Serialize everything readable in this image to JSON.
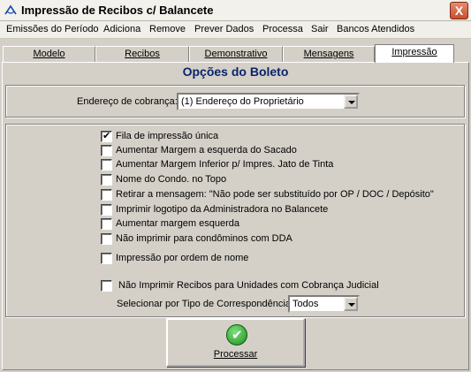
{
  "window": {
    "title": "Impressão de Recibos c/ Balancete",
    "close_label": "X"
  },
  "menu": [
    "Emissões do Período",
    "Adiciona",
    "Remove",
    "Prever Dados",
    "Processa",
    "Sair",
    "Bancos Atendidos"
  ],
  "tabs": [
    {
      "label": "Modelo",
      "active": false
    },
    {
      "label": "Recibos",
      "active": false
    },
    {
      "label": "Demonstrativo",
      "active": false
    },
    {
      "label": "Mensagens",
      "active": false
    },
    {
      "label": "Impressão",
      "active": true
    }
  ],
  "heading": "Opções do Boleto",
  "endereco": {
    "label": "Endereço de cobrança:",
    "value": "(1) Endereço do Proprietário"
  },
  "options": [
    {
      "label": "Fila de impressão única",
      "checked": true
    },
    {
      "label": "Aumentar Margem a esquerda do Sacado",
      "checked": false
    },
    {
      "label": "Aumentar Margem Inferior p/ Impres. Jato de Tinta",
      "checked": false
    },
    {
      "label": "Nome do Condo. no Topo",
      "checked": false
    },
    {
      "label": "Retirar a mensagem:  \"Não pode ser substituído por OP / DOC / Depósito\"",
      "checked": false
    },
    {
      "label": "Imprimir logotipo da Administradora no Balancete",
      "checked": false
    },
    {
      "label": "Aumentar margem esquerda",
      "checked": false
    },
    {
      "label": "Não imprimir para condôminos com DDA",
      "checked": false
    },
    {
      "label": "Impressão por ordem de nome",
      "checked": false
    },
    {
      "label": "Não Imprimir Recibos para Unidades com Cobrança Judicial",
      "checked": false
    }
  ],
  "correspondencia": {
    "label": "Selecionar por Tipo de Correspondência:",
    "value": "Todos"
  },
  "process_button": {
    "label": "Processar",
    "icon": "check-icon"
  }
}
